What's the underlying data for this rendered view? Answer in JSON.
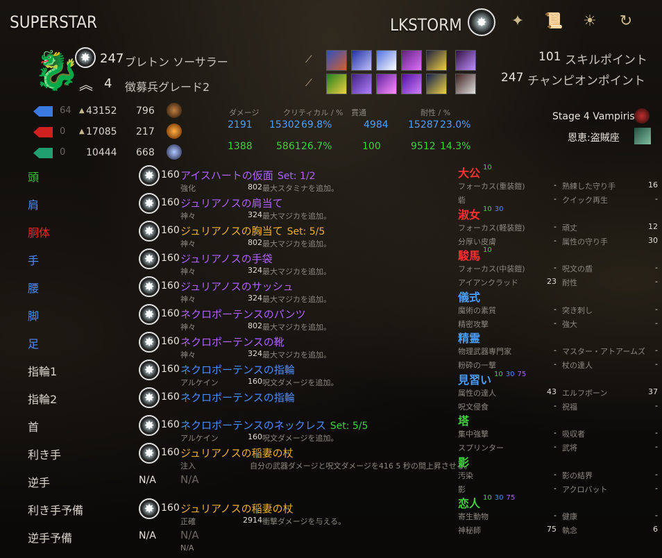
{
  "character_name": "SUPERSTAR",
  "account_name": "LKSTORM",
  "icons": [
    "champion-star-icon",
    "skills-icon",
    "scroll-icon",
    "sun-icon",
    "refresh-icon"
  ],
  "level": "247",
  "race_class": "ブレトン ソーサラー",
  "rank": "4",
  "rank_title": "徴募兵グレード2",
  "skill_points_value": "101",
  "skill_points_label": "スキルポイント",
  "champion_points_value": "247",
  "champion_points_label": "チャンピオンポイント",
  "resources": [
    {
      "dim": "64",
      "max": "43152",
      "regen": "796",
      "color": "#3a7ae0"
    },
    {
      "dim": "0",
      "max": "17085",
      "regen": "217",
      "color": "#d02020"
    },
    {
      "dim": "0",
      "max": "10444",
      "regen": "668",
      "color": "#20a070"
    }
  ],
  "stat_headers": {
    "damage": "ダメージ",
    "crit": "クリティカル / %",
    "pen": "貫通",
    "resist": "耐性 / %"
  },
  "stats_magic": {
    "damage": "2191",
    "crit": "15302",
    "crit_pct": "69.8%",
    "pen": "4984",
    "resist": "15287",
    "resist_pct": "23.0%",
    "color": "#4aa0ff"
  },
  "stats_physical": {
    "damage": "1388",
    "crit": "5861",
    "crit_pct": "26.7%",
    "pen": "100",
    "resist": "9512",
    "resist_pct": "14.3%",
    "color": "#40d040"
  },
  "vampirism": "Stage 4 Vampirism",
  "boon": "恩恵:盗賊座",
  "equipment": [
    {
      "slot": "頭",
      "slot_color": "#40c040",
      "has_cp": true,
      "level": "160",
      "name": "アイスハートの仮面",
      "name_color": "#b060ff",
      "set": "Set: 1/2",
      "set_color": "#b060ff",
      "trait": "強化",
      "value": "802",
      "effect": "最大スタミナを追加。"
    },
    {
      "slot": "肩",
      "slot_color": "#4a8cff",
      "has_cp": true,
      "level": "160",
      "name": "ジュリアノスの肩当て",
      "name_color": "#b060ff",
      "set": "",
      "set_color": "",
      "trait": "神々",
      "value": "324",
      "effect": "最大マジカを追加。"
    },
    {
      "slot": "胴体",
      "slot_color": "#ff2020",
      "has_cp": true,
      "level": "160",
      "name": "ジュリアノスの胸当て",
      "name_color": "#f0b030",
      "set": "Set: 5/5",
      "set_color": "#f0b030",
      "trait": "神々",
      "value": "802",
      "effect": "最大マジカを追加。"
    },
    {
      "slot": "手",
      "slot_color": "#4a8cff",
      "has_cp": true,
      "level": "160",
      "name": "ジュリアノスの手袋",
      "name_color": "#b060ff",
      "set": "",
      "set_color": "",
      "trait": "神々",
      "value": "324",
      "effect": "最大マジカを追加。"
    },
    {
      "slot": "腰",
      "slot_color": "#4a8cff",
      "has_cp": true,
      "level": "160",
      "name": "ジュリアノスのサッシュ",
      "name_color": "#b060ff",
      "set": "",
      "set_color": "",
      "trait": "神々",
      "value": "324",
      "effect": "最大マジカを追加。"
    },
    {
      "slot": "脚",
      "slot_color": "#4a8cff",
      "has_cp": true,
      "level": "160",
      "name": "ネクロポーテンスのパンツ",
      "name_color": "#b060ff",
      "set": "",
      "set_color": "",
      "trait": "神々",
      "value": "802",
      "effect": "最大マジカを追加。"
    },
    {
      "slot": "足",
      "slot_color": "#4a8cff",
      "has_cp": true,
      "level": "160",
      "name": "ネクロポーテンスの靴",
      "name_color": "#b060ff",
      "set": "",
      "set_color": "",
      "trait": "神々",
      "value": "324",
      "effect": "最大マジカを追加。"
    },
    {
      "slot": "指輪1",
      "slot_color": "#d8d4cc",
      "has_cp": true,
      "level": "160",
      "name": "ネクロポーテンスの指輪",
      "name_color": "#4a8cff",
      "set": "",
      "set_color": "",
      "trait": "アルケイン",
      "value": "160",
      "effect": "呪文ダメージを追加。"
    },
    {
      "slot": "指輪2",
      "slot_color": "#d8d4cc",
      "has_cp": true,
      "level": "160",
      "name": "ネクロポーテンスの指輪",
      "name_color": "#4a8cff",
      "set": "",
      "set_color": "",
      "trait": "",
      "value": "",
      "effect": ""
    },
    {
      "slot": "首",
      "slot_color": "#d8d4cc",
      "has_cp": true,
      "level": "160",
      "name": "ネクロポーテンスのネックレス",
      "name_color": "#4a8cff",
      "set": "Set: 5/5",
      "set_color": "#40d040",
      "trait": "アルケイン",
      "value": "160",
      "effect": "呪文ダメージを追加。"
    },
    {
      "slot": "利き手",
      "slot_color": "#d8d4cc",
      "has_cp": true,
      "level": "160",
      "name": "ジュリアノスの稲妻の杖",
      "name_color": "#f0b030",
      "set": "",
      "set_color": "",
      "trait": "注入",
      "value": "",
      "effect": "自分の武器ダメージと呪文ダメージを416  5 秒の間上昇させる。"
    },
    {
      "slot": "逆手",
      "slot_color": "#d8d4cc",
      "has_cp": false,
      "level": "N/A",
      "name": "N/A",
      "name_color": "#6a6660",
      "set": "",
      "set_color": "",
      "trait": "",
      "value": "",
      "effect": ""
    },
    {
      "slot": "利き手予備",
      "slot_color": "#d8d4cc",
      "has_cp": true,
      "level": "160",
      "name": "ジュリアノスの稲妻の杖",
      "name_color": "#f0b030",
      "set": "",
      "set_color": "",
      "trait": "正確",
      "value": "2914",
      "effect": "衝撃ダメージを与える。"
    },
    {
      "slot": "逆手予備",
      "slot_color": "#d8d4cc",
      "has_cp": false,
      "level": "N/A",
      "name": "N/A",
      "name_color": "#6a6660",
      "set": "",
      "set_color": "",
      "trait": "N/A",
      "value": "",
      "effect": ""
    }
  ],
  "champion": [
    {
      "title": "大公",
      "title_color": "#ff3030",
      "levels": [
        {
          "v": "10",
          "c": "#40d040"
        }
      ],
      "rows": [
        {
          "l": "フォーカス(重装鎧)",
          "lv": "-",
          "r": "熟練した守り手",
          "rv": "16"
        },
        {
          "l": "砦",
          "lv": "-",
          "r": "クイック再生",
          "rv": "-"
        }
      ]
    },
    {
      "title": "淑女",
      "title_color": "#ff3030",
      "levels": [
        {
          "v": "10",
          "c": "#40d040"
        },
        {
          "v": "30",
          "c": "#4a8cff"
        }
      ],
      "rows": [
        {
          "l": "フォーカス(軽装鎧)",
          "lv": "-",
          "r": "頑丈",
          "rv": "12"
        },
        {
          "l": "分厚い皮膚",
          "lv": "-",
          "r": "属性の守り手",
          "rv": "30"
        }
      ]
    },
    {
      "title": "駿馬",
      "title_color": "#ff3030",
      "levels": [
        {
          "v": "10",
          "c": "#40d040"
        }
      ],
      "rows": [
        {
          "l": "フォーカス(中装鎧)",
          "lv": "-",
          "r": "呪文の盾",
          "rv": "-"
        },
        {
          "l": "アイアンクラッド",
          "lv": "23",
          "r": "耐性",
          "rv": "-"
        }
      ]
    },
    {
      "title": "儀式",
      "title_color": "#4a9cff",
      "levels": [],
      "rows": [
        {
          "l": "魔術の素質",
          "lv": "-",
          "r": "突き刺し",
          "rv": "-"
        },
        {
          "l": "精密攻撃",
          "lv": "-",
          "r": "強大",
          "rv": "-"
        }
      ]
    },
    {
      "title": "精霊",
      "title_color": "#4a9cff",
      "levels": [],
      "rows": [
        {
          "l": "物理武器専門家",
          "lv": "-",
          "r": "マスター・アトアームズ",
          "rv": "-"
        },
        {
          "l": "粉砕の一撃",
          "lv": "-",
          "r": "杖の達人",
          "rv": "-"
        }
      ]
    },
    {
      "title": "見習い",
      "title_color": "#4a9cff",
      "levels": [
        {
          "v": "10",
          "c": "#40d040"
        },
        {
          "v": "30",
          "c": "#4a8cff"
        },
        {
          "v": "75",
          "c": "#b060ff"
        }
      ],
      "rows": [
        {
          "l": "属性の達人",
          "lv": "43",
          "r": "エルフボーン",
          "rv": "37"
        },
        {
          "l": "呪文侵食",
          "lv": "-",
          "r": "祝福",
          "rv": "-"
        }
      ]
    },
    {
      "title": "塔",
      "title_color": "#40d040",
      "levels": [],
      "rows": [
        {
          "l": "集中強撃",
          "lv": "-",
          "r": "吸収者",
          "rv": "-"
        },
        {
          "l": "スプリンター",
          "lv": "-",
          "r": "武将",
          "rv": "-"
        }
      ]
    },
    {
      "title": "影",
      "title_color": "#40d040",
      "levels": [],
      "rows": [
        {
          "l": "汚染",
          "lv": "-",
          "r": "影の結界",
          "rv": "-"
        },
        {
          "l": "影",
          "lv": "-",
          "r": "アクロバット",
          "rv": "-"
        }
      ]
    },
    {
      "title": "恋人",
      "title_color": "#40d040",
      "levels": [
        {
          "v": "10",
          "c": "#40d040"
        },
        {
          "v": "30",
          "c": "#4a8cff"
        },
        {
          "v": "75",
          "c": "#b060ff"
        }
      ],
      "rows": [
        {
          "l": "寄生動物",
          "lv": "-",
          "r": "健康",
          "rv": "-"
        },
        {
          "l": "神秘師",
          "lv": "75",
          "r": "執念",
          "rv": "6"
        }
      ]
    }
  ]
}
